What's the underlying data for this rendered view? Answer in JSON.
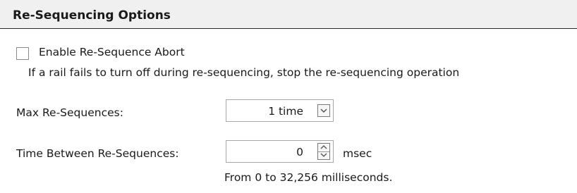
{
  "header": {
    "title": "Re-Sequencing Options"
  },
  "abort": {
    "checked": false,
    "label": "Enable Re-Sequence Abort",
    "description": "If a rail fails to turn off during re-sequencing, stop the re-sequencing operation"
  },
  "max_resequences": {
    "label": "Max Re-Sequences:",
    "value": "1 time"
  },
  "time_between": {
    "label": "Time Between Re-Sequences:",
    "value": "0",
    "unit": "msec",
    "hint": "From 0 to 32,256 milliseconds."
  },
  "icons": {
    "dropdown": "chevron-down-icon",
    "spin_up": "chevron-up-icon",
    "spin_down": "chevron-down-icon"
  }
}
